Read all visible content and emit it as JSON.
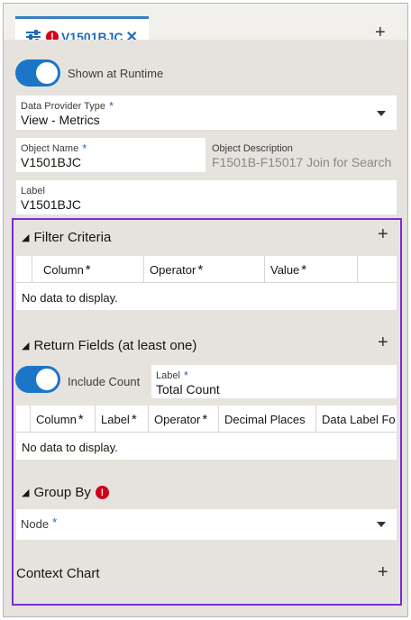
{
  "tab": {
    "title": "V1501BJC",
    "close": "✕",
    "add": "+"
  },
  "runtime_toggle": {
    "label": "Shown at Runtime",
    "on": true
  },
  "data_provider": {
    "label": "Data Provider Type",
    "value": "View - Metrics",
    "required": "*"
  },
  "object_name": {
    "label": "Object Name",
    "value": "V1501BJC",
    "required": "*"
  },
  "object_description": {
    "label": "Object Description",
    "value": "F1501B-F15017 Join for Search"
  },
  "label_field": {
    "label": "Label",
    "value": "V1501BJC"
  },
  "filter_criteria": {
    "title": "Filter Criteria",
    "add": "+",
    "columns": [
      "Column",
      "Operator",
      "Value"
    ],
    "star": "*",
    "empty": "No data to display."
  },
  "return_fields": {
    "title": "Return Fields (at least one)",
    "add": "+",
    "include_count": {
      "label": "Include Count",
      "on": true
    },
    "count_label": {
      "label": "Label",
      "value": "Total Count",
      "required": "*"
    },
    "columns": [
      "Column",
      "Label",
      "Operator",
      "Decimal Places",
      "Data Label Fo"
    ],
    "empty": "No data to display."
  },
  "group_by": {
    "title": "Group By",
    "error": "!",
    "node": {
      "label": "Node",
      "required": "*"
    }
  },
  "context_chart": {
    "title": "Context Chart",
    "add": "+"
  },
  "colors": {
    "accent": "#1b76c7",
    "highlight_border": "#7a2bd6",
    "error": "#d0021b"
  },
  "icons": {
    "tab": "sliders-icon",
    "error": "error-icon",
    "dropdown": "chevron-down-icon",
    "collapse": "triangle-icon"
  }
}
